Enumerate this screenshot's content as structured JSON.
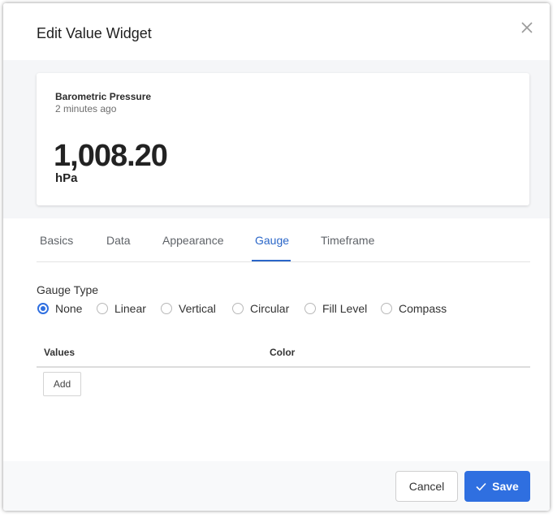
{
  "dialog": {
    "title": "Edit Value Widget",
    "close_icon": "close-icon"
  },
  "preview": {
    "title": "Barometric Pressure",
    "subtitle": "2 minutes ago",
    "value": "1,008.20",
    "unit": "hPa"
  },
  "tabs": [
    {
      "label": "Basics",
      "active": false
    },
    {
      "label": "Data",
      "active": false
    },
    {
      "label": "Appearance",
      "active": false
    },
    {
      "label": "Gauge",
      "active": true
    },
    {
      "label": "Timeframe",
      "active": false
    }
  ],
  "gauge": {
    "label": "Gauge Type",
    "options": [
      {
        "label": "None",
        "checked": true
      },
      {
        "label": "Linear",
        "checked": false
      },
      {
        "label": "Vertical",
        "checked": false
      },
      {
        "label": "Circular",
        "checked": false
      },
      {
        "label": "Fill Level",
        "checked": false
      },
      {
        "label": "Compass",
        "checked": false
      }
    ]
  },
  "values_table": {
    "columns": [
      "Values",
      "Color"
    ],
    "add_label": "Add"
  },
  "footer": {
    "cancel_label": "Cancel",
    "save_label": "Save",
    "save_icon": "check-icon"
  },
  "colors": {
    "accent": "#2f6fe0",
    "tab_active": "#2a66c8"
  }
}
